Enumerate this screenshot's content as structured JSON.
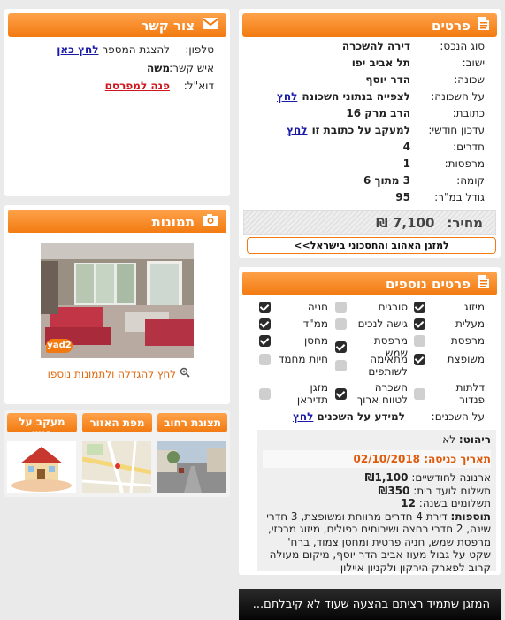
{
  "details": {
    "title": "פרטים",
    "rows": [
      {
        "label": "סוג הנכס:",
        "value": "דירה להשכרה"
      },
      {
        "label": "ישוב:",
        "value": "תל אביב יפו"
      },
      {
        "label": "שכונה:",
        "value": "הדר יוסף"
      },
      {
        "label": "על השכונה:",
        "value": "לצפייה בנתוני השכונה",
        "link": "לחץ"
      },
      {
        "label": "כתובת:",
        "value": "הרב מרק 16"
      },
      {
        "label": "עדכון חודשי:",
        "value": "למעקב על כתובת זו",
        "link": "לחץ"
      },
      {
        "label": "חדרים:",
        "value": "4"
      },
      {
        "label": "מרפסות:",
        "value": "1"
      },
      {
        "label": "קומה:",
        "value": "3 מתוך 6"
      },
      {
        "label": "גודל במ\"ר:",
        "value": "95"
      }
    ],
    "price_label": "מחיר:",
    "price_value": "7,100 ₪",
    "ac_link": "למזגן האהוב והחסכוני בישראל>>"
  },
  "contact": {
    "title": "צור קשר",
    "phone_label": "טלפון:",
    "phone_text": "להצגת המספר",
    "phone_link": "לחץ כאן",
    "person_label": "איש קשר:",
    "person_value": "משה",
    "email_label": "דוא\"ל:",
    "email_link": "פנה למפרסם"
  },
  "photos": {
    "title": "תמונות",
    "watermark": "yad2",
    "enlarge_link": "לחץ להגדלה ולתמונות נוספו"
  },
  "tabs": {
    "street": "תצוגת רחוב",
    "map": "מפת האזור",
    "follow": "מעקב על בניין"
  },
  "extra": {
    "title": "פרטים נוספים",
    "features": [
      {
        "label": "מיזוג",
        "checked": true
      },
      {
        "label": "סורגים",
        "checked": false
      },
      {
        "label": "חניה",
        "checked": true
      },
      {
        "label": "מעלית",
        "checked": true
      },
      {
        "label": "גישה לנכים",
        "checked": false
      },
      {
        "label": "ממ\"ד",
        "checked": true
      },
      {
        "label": "מרפסת",
        "checked": false
      },
      {
        "label": "מרפסת שמש",
        "checked": true
      },
      {
        "label": "מחסן",
        "checked": true
      },
      {
        "label": "משופצת",
        "checked": true
      },
      {
        "label": "מתאימה לשותפים",
        "checked": false
      },
      {
        "label": "חיות מחמד",
        "checked": false
      },
      {
        "label": "דלתות פנדור",
        "checked": false
      },
      {
        "label": "השכרה לטווח ארוך",
        "checked": true
      },
      {
        "label": "מזגן תדיראן",
        "checked": false
      }
    ],
    "tenants_label": "על השכנים:",
    "tenants_value": "למידע על השכנים",
    "tenants_link": "לחץ"
  },
  "info": {
    "furniture_label": "ריהוט:",
    "furniture_value": "לא",
    "entry_label": "תאריך כניסה:",
    "entry_value": "02/10/2018",
    "arnona_label": "ארנונה לחודשיים:",
    "arnona_value": "₪1,100",
    "vaad_label": "תשלום לועד בית:",
    "vaad_value": "₪350",
    "payments_label": "תשלומים בשנה:",
    "payments_value": "12",
    "additions_label": "תוספות:",
    "additions_text": "דירת 4 חדרים מרווחת ומשופצת, 3 חדרי שינה, 2 חדרי רחצה ושירותים כפולים, מיזוג מרכזי, מרפסת שמש, חניה פרטית ומחסן צמוד, ברח' שקט על גבול מעוז אביב-הדר יוסף, מיקום מעולה קרוב לפארק הירקון ולקניון איילון"
  },
  "banner": {
    "text": "המזגן שתמיד רציתם  בהצעה שעוד לא קיבלתם..."
  },
  "colors": {
    "orange": "#f27a10",
    "red_date": "#e05a0a",
    "link": "#1a1aa8"
  }
}
